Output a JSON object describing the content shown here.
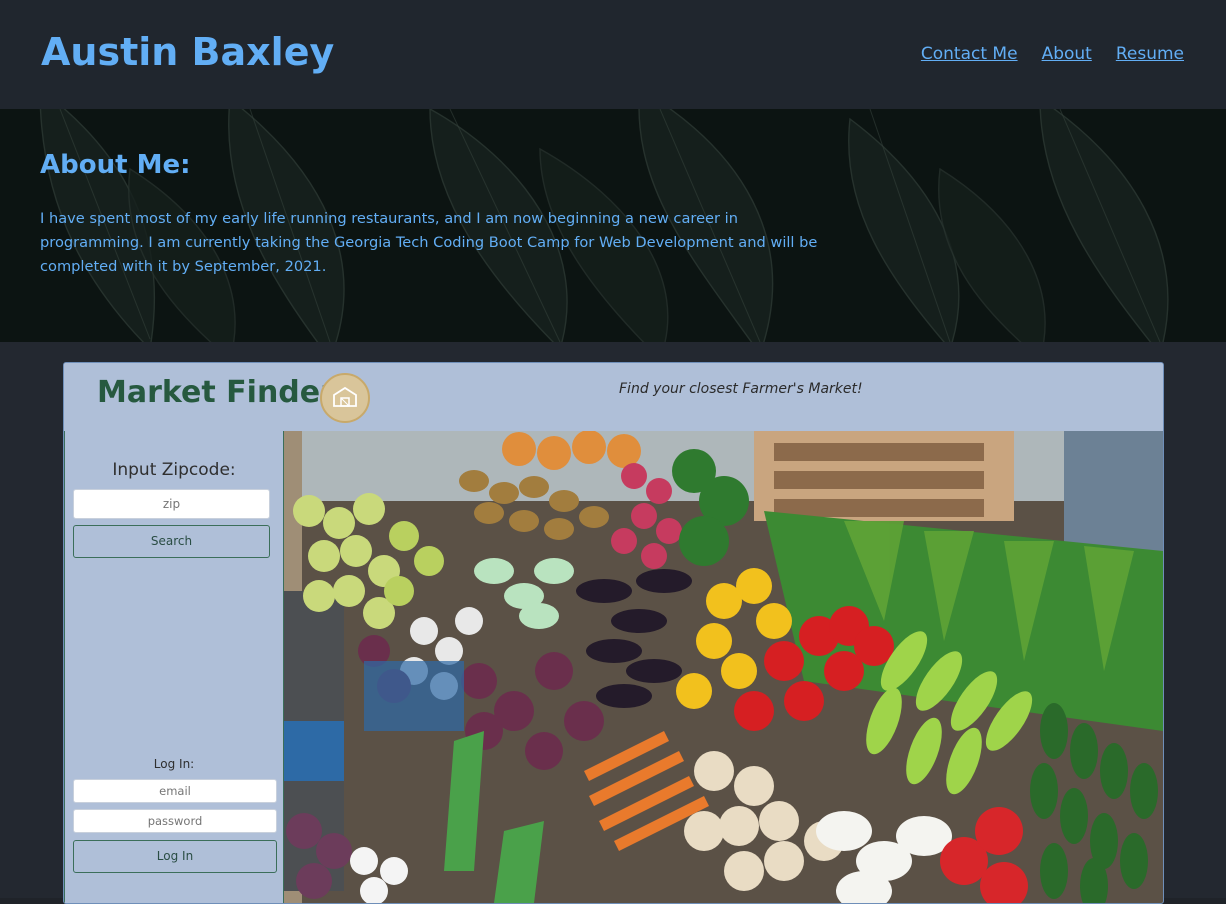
{
  "header": {
    "title": "Austin Baxley",
    "nav": [
      "Contact Me",
      "About",
      "Resume"
    ]
  },
  "about": {
    "heading": "About Me:",
    "text": "I have spent most of my early life running restaurants, and I am now beginning a new career in programming. I am currently taking the Georgia Tech Coding Boot Camp for Web Development and will be completed with it by September, 2021."
  },
  "project": {
    "title": "Market Finder",
    "tagline": "Find your closest Farmer's Market!",
    "zip_label": "Input Zipcode:",
    "zip_placeholder": "zip",
    "search_label": "Search",
    "login_label": "Log In:",
    "email_placeholder": "email",
    "password_placeholder": "password",
    "login_button": "Log In"
  },
  "colors": {
    "accent": "#62aef5",
    "header_bg": "#20262e",
    "card_bg": "#afbfd8",
    "brand_green": "#26593f"
  },
  "icons": {
    "logo": "market-barn-icon"
  }
}
